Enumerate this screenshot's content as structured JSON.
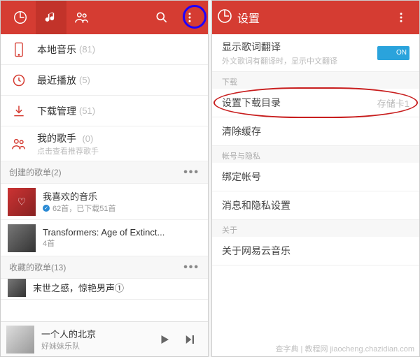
{
  "left": {
    "menu": [
      {
        "label": "本地音乐",
        "count": "(81)",
        "sub": ""
      },
      {
        "label": "最近播放",
        "count": "(5)",
        "sub": ""
      },
      {
        "label": "下载管理",
        "count": "(51)",
        "sub": ""
      },
      {
        "label": "我的歌手",
        "count": "(0)",
        "sub": "点击查看推荐歌手"
      }
    ],
    "sections": {
      "created": {
        "label": "创建的歌单(2)",
        "more": "•••"
      },
      "collected": {
        "label": "收藏的歌单(13)",
        "more": "•••"
      }
    },
    "playlists": [
      {
        "title": "我喜欢的音乐",
        "sub": "62首，已下载51首",
        "verified": true
      },
      {
        "title": "Transformers: Age of Extinct...",
        "sub": "4首",
        "verified": false
      }
    ],
    "collected_first": {
      "title": "末世之感，惊艳男声①"
    },
    "playbar": {
      "title": "一个人的北京",
      "sub": "好妹妹乐队"
    }
  },
  "right": {
    "title": "设置",
    "lyrics": {
      "label": "显示歌词翻译",
      "sub": "外文歌词有翻译时，显示中文翻译",
      "switch": "ON"
    },
    "download_section": "下载",
    "download_dir": {
      "label": "设置下载目录",
      "value": "存储卡1"
    },
    "clear_cache": "清除缓存",
    "account_section": "帐号与隐私",
    "bind_account": "绑定帐号",
    "privacy_setting": "消息和隐私设置",
    "about_section": "关于",
    "about_app": "关于网易云音乐"
  },
  "watermark": "查字典 | 教程网  jiaocheng.chazidian.com"
}
